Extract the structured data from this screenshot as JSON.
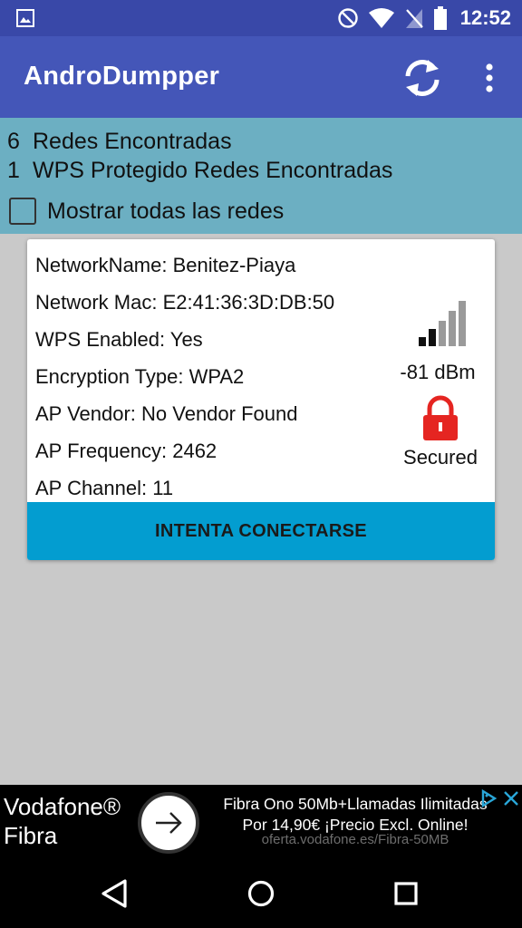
{
  "status_bar": {
    "time": "12:52",
    "icons": [
      "image-icon",
      "do-not-disturb-icon",
      "wifi-icon",
      "no-sim-icon",
      "battery-icon"
    ]
  },
  "app_bar": {
    "title": "AndroDumpper",
    "icons": [
      "refresh-icon",
      "overflow-menu-icon"
    ]
  },
  "summary": {
    "networks_count": "6",
    "networks_label": "Redes Encontradas",
    "wps_count": "1",
    "wps_label": "WPS Protegido Redes Encontradas",
    "show_all_label": "Mostrar todas las redes",
    "show_all_checked": false
  },
  "network_card": {
    "network_name": "NetworkName: Benitez-Piaya",
    "network_mac": "Network Mac: E2:41:36:3D:DB:50",
    "wps_enabled": "WPS Enabled: Yes",
    "encryption": "Encryption Type: WPA2",
    "vendor": "AP Vendor: No Vendor Found",
    "frequency": "AP Frequency: 2462",
    "channel": "AP Channel: 11",
    "signal": "-81 dBm",
    "signal_bars_filled": 2,
    "signal_bars_total": 5,
    "security": "Secured",
    "connect_label": "INTENTA CONECTARSE",
    "colors": {
      "button": "#039dd0",
      "lock": "#e52521"
    }
  },
  "ad": {
    "brand_line1": "Vodafone®",
    "brand_line2": "Fibra",
    "headline1": "Fibra Ono 50Mb+Llamadas Ilimitadas",
    "headline2": "Por 14,90€ ¡Precio Excl. Online!",
    "url": "oferta.vodafone.es/Fibra-50MB",
    "icons": [
      "arrow-right-icon",
      "adchoices-icon",
      "close-icon"
    ]
  },
  "nav_bar": {
    "icons": [
      "back-icon",
      "home-icon",
      "recents-icon"
    ]
  },
  "colors": {
    "status_bar": "#3948a8",
    "app_bar": "#4456b8",
    "info_panel": "#6cafc2",
    "background": "#c9c9c9"
  }
}
